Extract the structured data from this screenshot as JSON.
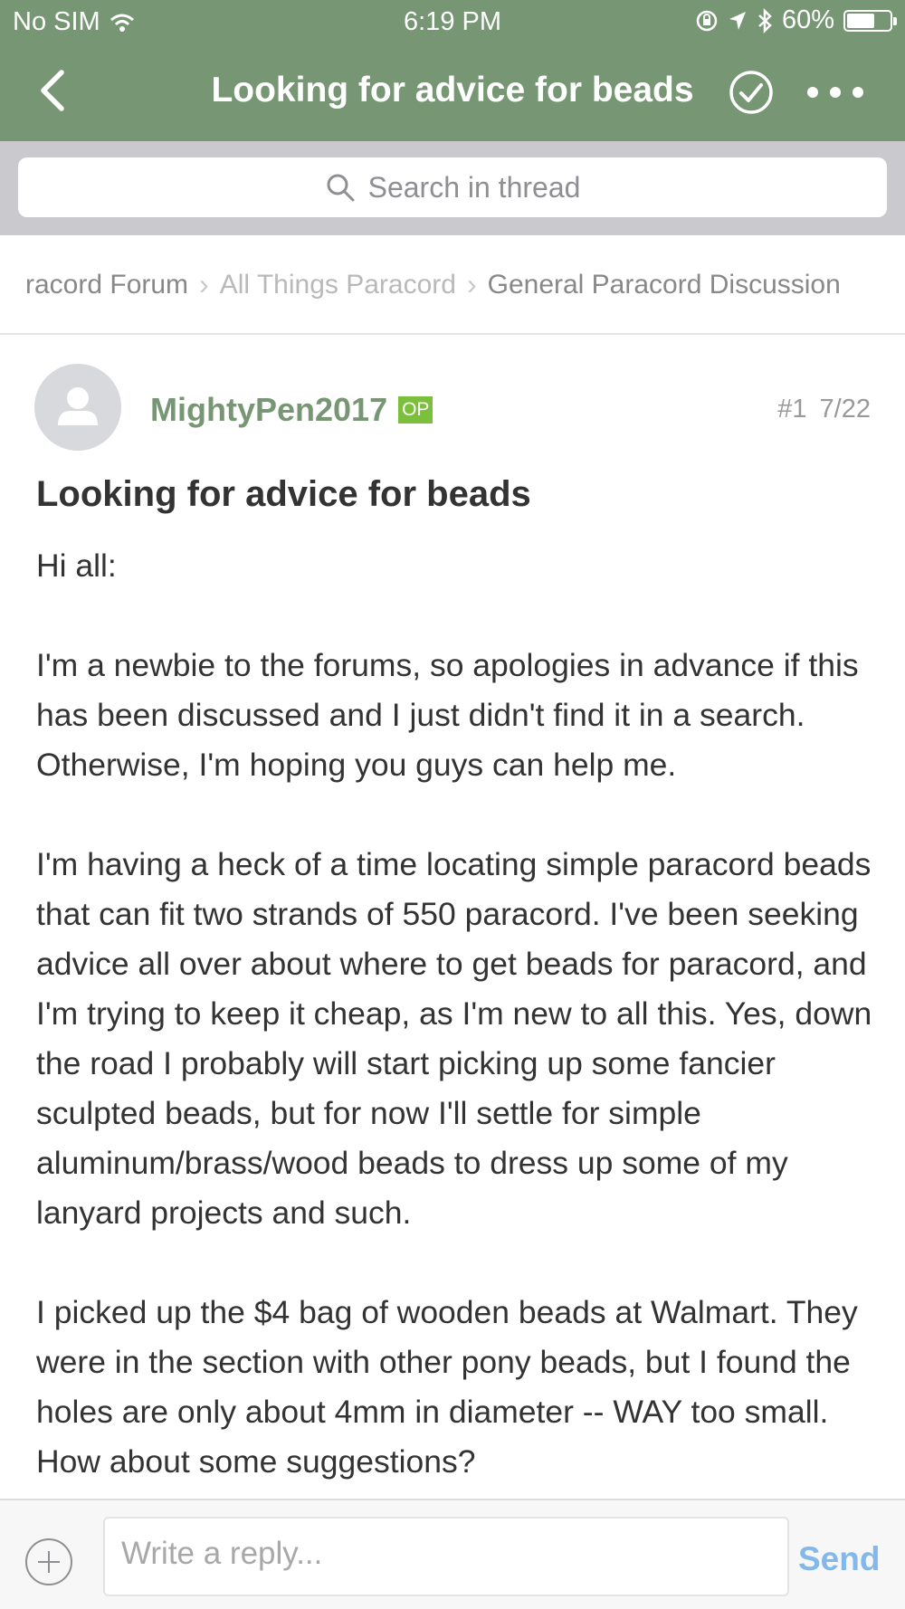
{
  "status_bar": {
    "carrier": "No SIM",
    "time": "6:19 PM",
    "battery": "60%",
    "battery_level": 0.6
  },
  "nav": {
    "title": "Looking for advice for beads",
    "icons": [
      "back-chevron-icon",
      "check-circle-icon",
      "more-dots-icon"
    ]
  },
  "search": {
    "placeholder": "Search in thread"
  },
  "breadcrumb": {
    "items": [
      "racord Forum",
      "All Things Paracord",
      "General Paracord Discussion"
    ]
  },
  "post": {
    "author": "MightyPen2017",
    "badge": "OP",
    "number": "#1",
    "date": "7/22",
    "title": "Looking for advice for beads",
    "paragraphs": [
      "Hi all:",
      "I'm a newbie to the forums, so apologies in advance if this has been discussed and I just didn't find it in a search. Otherwise, I'm hoping you guys can help me.",
      "I'm having a heck of a time locating simple paracord beads that can fit two strands of 550 paracord. I've been seeking advice all over about where to get beads for paracord, and I'm trying to keep it cheap, as I'm new to all this. Yes, down the road I probably will start picking up some fancier sculpted beads, but for now I'll settle for simple aluminum/brass/wood beads to dress up some of my lanyard projects and such.",
      "I picked up the $4 bag of wooden beads at Walmart. They were in the section with other pony beads, but I found the holes are only about 4mm in diameter -- WAY too small. How about some suggestions?"
    ]
  },
  "reply": {
    "placeholder": "Write a reply...",
    "send_label": "Send"
  },
  "colors": {
    "header": "#779674",
    "accent_green": "#779674",
    "op_badge": "#7bbf3c",
    "send": "#83b8e8"
  }
}
